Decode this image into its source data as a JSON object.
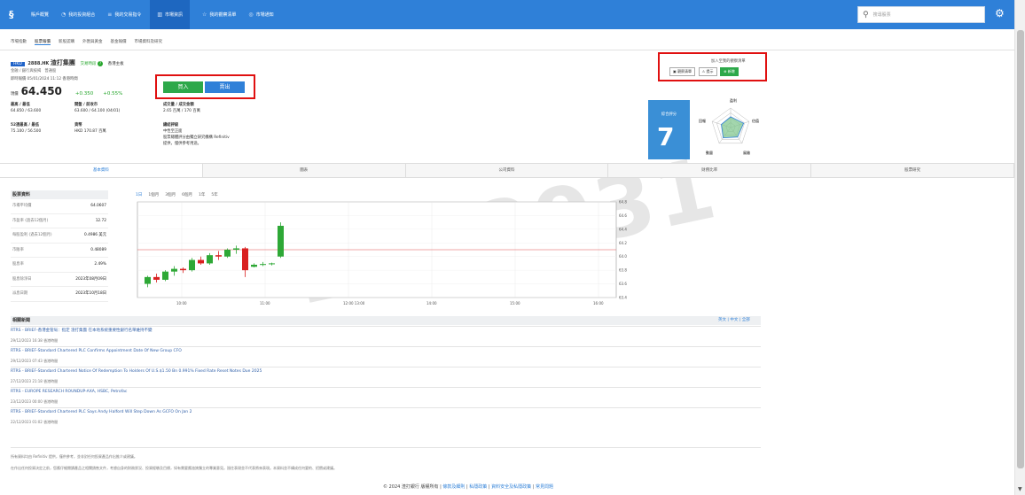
{
  "nav": {
    "items": [
      {
        "label": "賬戶概覽",
        "icon": "home-icon"
      },
      {
        "label": "我的投資組合",
        "icon": "pie-icon"
      },
      {
        "label": "我的交易指令",
        "icon": "list-icon"
      },
      {
        "label": "市場資訊",
        "icon": "chart-icon"
      },
      {
        "label": "我的觀察清單",
        "icon": "star-icon"
      },
      {
        "label": "市場通知",
        "icon": "bell-icon"
      }
    ],
    "active_index": 3,
    "search_placeholder": "搜尋股票"
  },
  "subtabs": [
    "市場指數",
    "股票報價",
    "新股認購",
    "外匯與黃金",
    "基金報價",
    "市場資料及研究"
  ],
  "quote": {
    "exchange": "HKD",
    "code": "2888.HK",
    "name": "渣打集團",
    "status": "交易時段",
    "market": "香港主板",
    "board": "金融 / 銀行與按揭",
    "type": "普通股",
    "time": "即時報價 05/01/2024 11:12 香港時間",
    "price_label": "現價",
    "price": "64.450",
    "change": "+0.350",
    "change_pct": "+0.55%",
    "bid_ask_label": "最高 / 最低",
    "bid_ask": "64.850 / 63.600",
    "open_prev_label": "開盤 / 前收市",
    "open_prev": "63.600 / 64.100 (04/01)",
    "vol_label": "成交量 / 成交金額",
    "vol": "2.65 百萬 / 170 百萬",
    "wk_label": "52週最高 / 最低",
    "wk": "75.100 / 56.500",
    "currency_label": "貨幣",
    "currency": "HKD 170.87 百萬",
    "rating_label": "總結評級",
    "rating_lines": [
      "中性至正面",
      "股票總體評分由獨立研究機構 Refinitiv",
      "提供，僅供參考用途。"
    ]
  },
  "buttons": {
    "buy": "買入",
    "sell": "賣出"
  },
  "watch": {
    "title": "加入至我的觀察清單",
    "btns": [
      "觀察清單",
      "提示",
      "新增"
    ]
  },
  "score": {
    "label": "綜合評分",
    "value": "7"
  },
  "radar_labels": [
    "盈利",
    "估值",
    "風險",
    "動量",
    "回報"
  ],
  "tabs": [
    "基本資料",
    "圖表",
    "公司資料",
    "財務比率",
    "股票研究"
  ],
  "side": {
    "header": "股票資料",
    "rows": [
      [
        "市場平均價",
        "64.0607"
      ],
      [
        "市盈率 (過去12個月)",
        "12.72"
      ],
      [
        "每股盈利 (過去12個月)",
        "0.4986 美元"
      ],
      [
        "市賬率",
        "0.48089"
      ],
      [
        "股息率",
        "2.49%"
      ],
      [
        "股息除淨日",
        "2023年08月09日"
      ],
      [
        "派息日期",
        "2023年10月18日"
      ]
    ]
  },
  "periods": [
    "1日",
    "1個月",
    "3個月",
    "6個月",
    "1年",
    "5年"
  ],
  "chart_data": {
    "type": "candlestick",
    "x_ticks": [
      "10:00",
      "11:00",
      "12:00 13:00",
      "14:00",
      "15:00",
      "16:00"
    ],
    "y_ticks": [
      "64.8",
      "64.6",
      "64.4",
      "64.2",
      "64.0",
      "63.8",
      "63.6",
      "63.4"
    ],
    "ylim": [
      63.4,
      64.8
    ],
    "prev_close": 64.1,
    "candles": [
      [
        63.6,
        63.72,
        63.55,
        63.7
      ],
      [
        63.7,
        63.75,
        63.62,
        63.66
      ],
      [
        63.66,
        63.8,
        63.64,
        63.78
      ],
      [
        63.78,
        63.86,
        63.72,
        63.82
      ],
      [
        63.82,
        63.84,
        63.76,
        63.8
      ],
      [
        63.8,
        63.98,
        63.78,
        63.95
      ],
      [
        63.95,
        64.0,
        63.88,
        63.9
      ],
      [
        63.9,
        64.05,
        63.88,
        64.02
      ],
      [
        64.02,
        64.08,
        63.95,
        64.0
      ],
      [
        64.0,
        64.12,
        63.98,
        64.1
      ],
      [
        64.1,
        64.16,
        64.04,
        64.12
      ],
      [
        64.12,
        64.14,
        63.7,
        63.8
      ],
      [
        63.85,
        63.9,
        63.84,
        63.88
      ],
      [
        63.88,
        63.92,
        63.86,
        63.89
      ],
      [
        63.89,
        63.91,
        63.87,
        63.9
      ],
      [
        64.0,
        64.5,
        63.98,
        64.45
      ]
    ]
  },
  "news": {
    "header": "相關新聞",
    "lang": "英文 | 中文 | 全部",
    "items": [
      {
        "title": "RTRS - BRIEF-香港金管局：指定 渣打集團 在本地系統重要性銀行名單維持不變",
        "date": "29/12/2023 16:38 香港時間"
      },
      {
        "title": "RTRS - BRIEF-Standard Chartered PLC Confirms Appointment Date Of New Group CFO",
        "date": "29/12/2023 07:43 香港時間"
      },
      {
        "title": "RTRS - BRIEF-Standard Chartered Notice Of Redemption To Holders Of U.S.$1.50 Bn 0.991% Fixed Rate Reset Notes Due 2025",
        "date": "27/12/2023 21:18 香港時間"
      },
      {
        "title": "RTRS - EUROPE RESEARCH ROUNDUP-AXA, HSBC, Petrofac",
        "date": "23/12/2023 00:00 香港時間"
      },
      {
        "title": "RTRS - BRIEF-Standard Chartered PLC Says Andy Halford Will Step Down As GCFO On Jan 2",
        "date": "22/12/2023 01:02 香港時間"
      }
    ]
  },
  "footer": {
    "line1": "所有資料均由 Refinitiv 提供，僅供參考，並非對任何投資產品作出推介或建議。",
    "line2": "在作出任何投資決定之前，您應仔細閱讀產品之相關銷售文件，考慮自身的財務狀況、投資經驗及目標，如有需要應諮詢獨立的專業意見。過往表現並不代表將來表現。本資料並不構成任何要約、招攬或建議。",
    "copyright": "© 2024 渣打銀行 版權所有 |",
    "links": [
      "條款及細則",
      "私隱政策",
      "資料安全及私隱政策",
      "常見問題"
    ]
  },
  "watermark": "2012931"
}
